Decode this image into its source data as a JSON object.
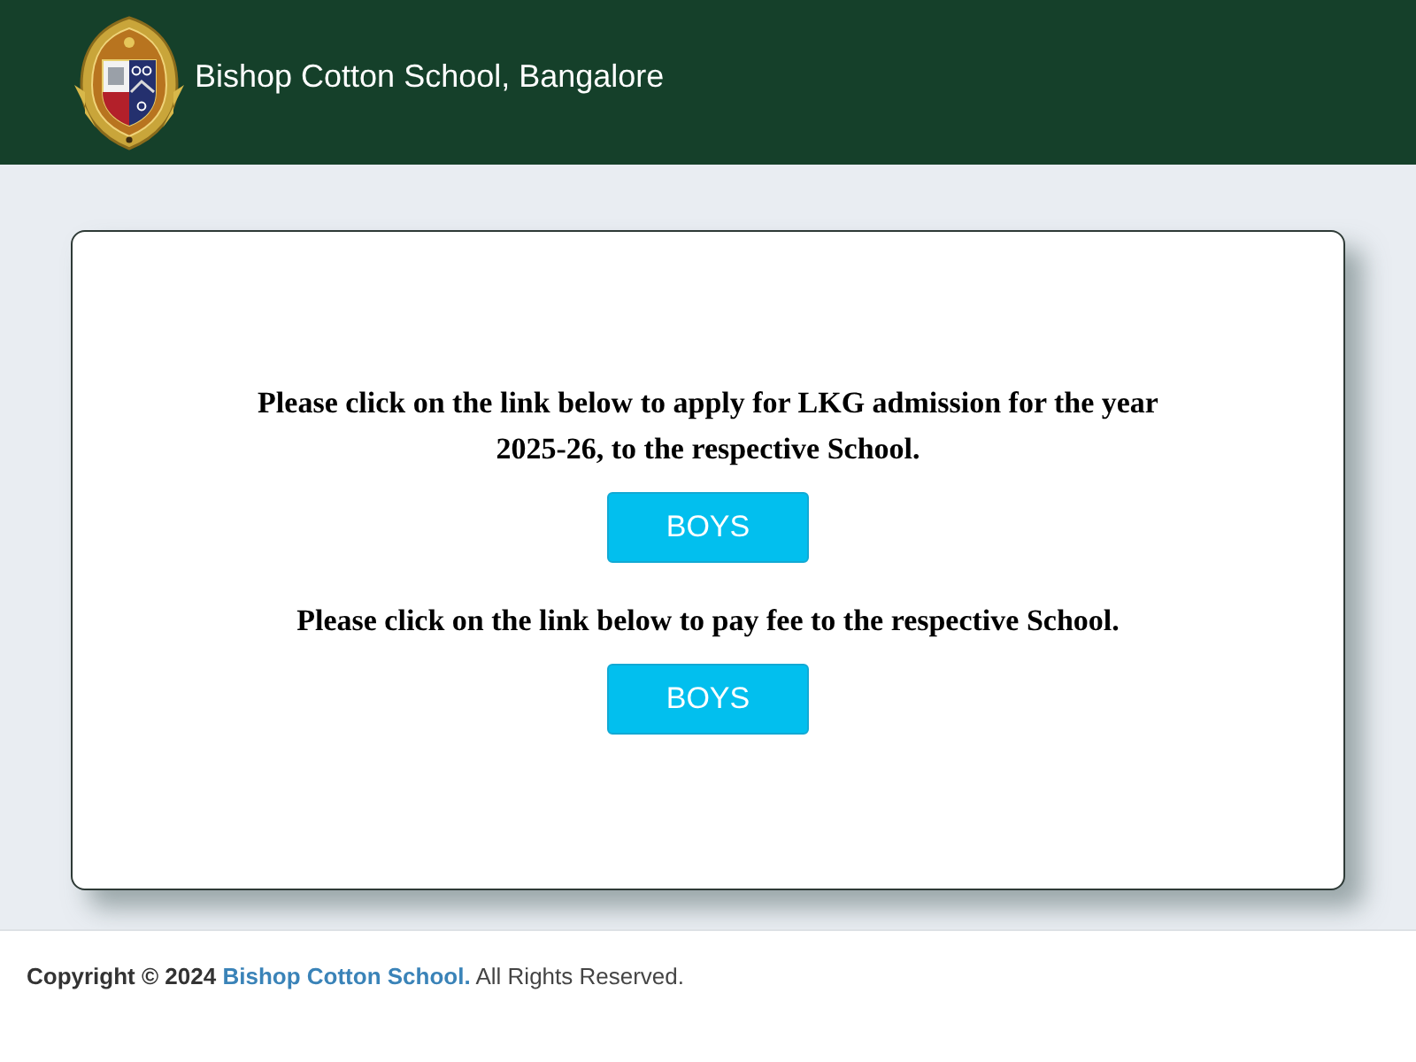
{
  "header": {
    "title": "Bishop Cotton School, Bangalore"
  },
  "sections": [
    {
      "message": "Please click on the link below to apply for LKG admission for the year 2025-26, to the respective School.",
      "button": "BOYS"
    },
    {
      "message": "Please click on the link below to pay fee to the respective School.",
      "button": "BOYS"
    }
  ],
  "footer": {
    "copyright": "Copyright © 2024",
    "link": "Bishop Cotton School.",
    "rights": "All Rights Reserved."
  }
}
